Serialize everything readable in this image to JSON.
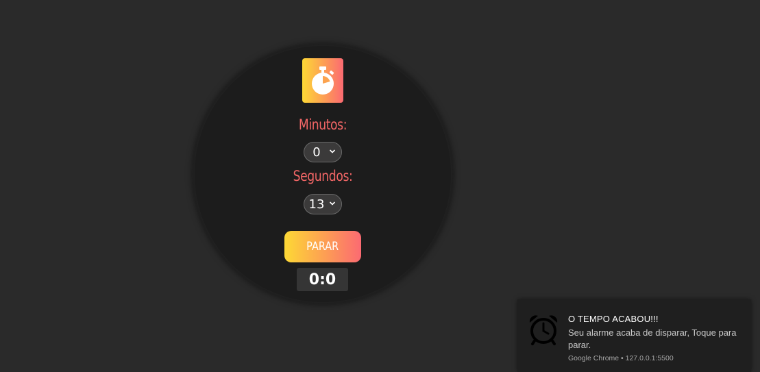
{
  "timer": {
    "minutes_label": "Minutos:",
    "minutes_value": "0",
    "seconds_label": "Segundos:",
    "seconds_value": "13",
    "stop_button_label": "PARAR",
    "display_time": "0:0"
  },
  "notification": {
    "title": "O TEMPO ACABOU!!!",
    "body": "Seu alarme acaba de disparar, Toque para parar.",
    "source": "Google Chrome • 127.0.0.1:5500"
  },
  "icons": {
    "logo": "stopwatch-icon",
    "notification": "alarm-clock-icon",
    "select": "chevron-down-icon"
  },
  "colors": {
    "background": "#2a2a2a",
    "circle": "#1c1c1c",
    "label": "#f26666",
    "gradient_start": "#fdd835",
    "gradient_end": "#fb6a72"
  }
}
